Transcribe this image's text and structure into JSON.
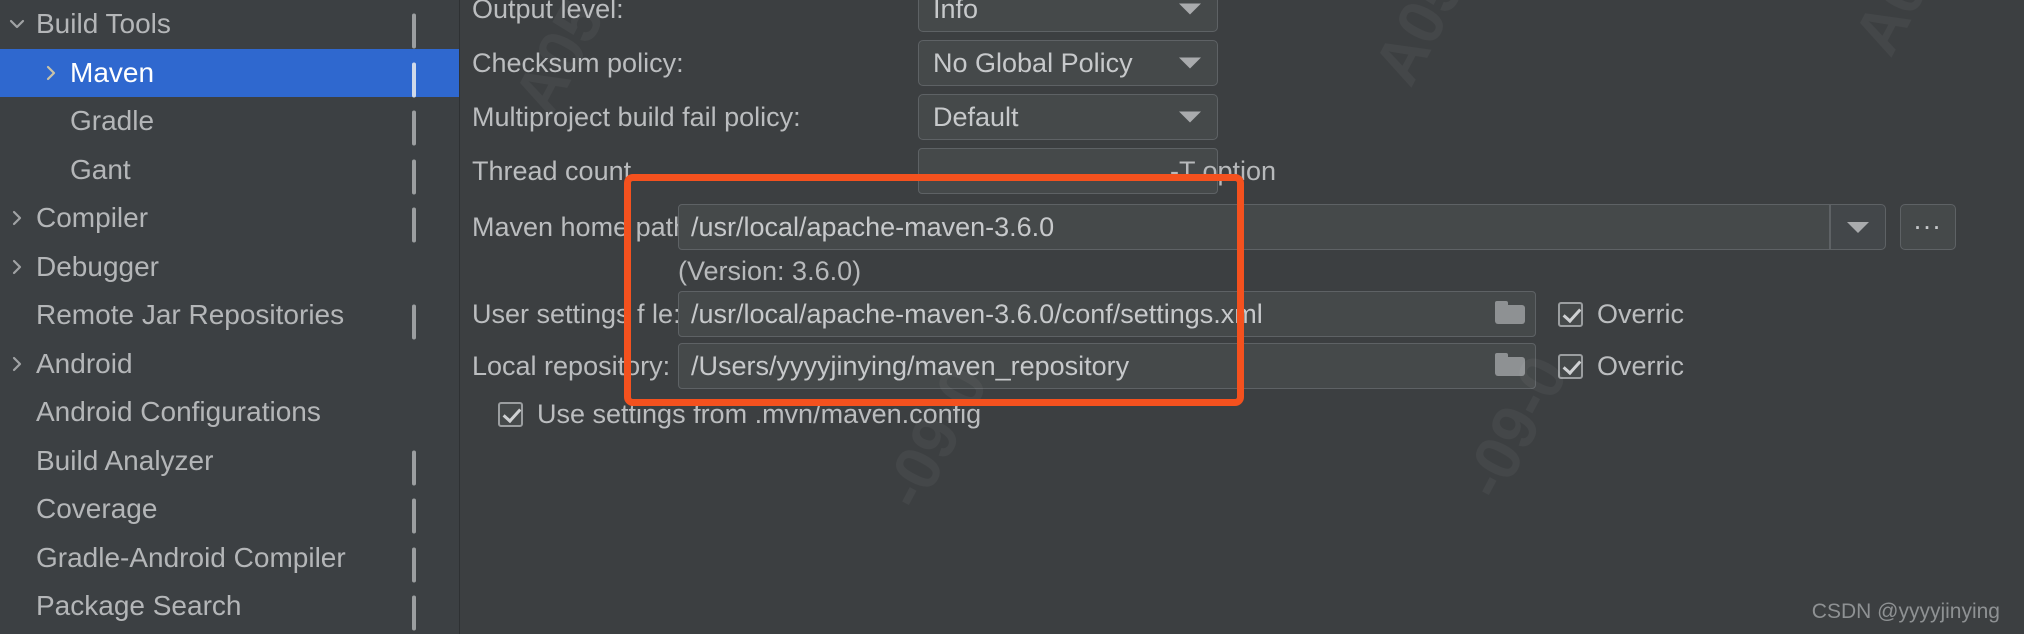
{
  "colors": {
    "accent_selection": "#2f68cf",
    "annotation": "#f4511e",
    "panel_bg": "#3c3f41",
    "sidebar_bg": "#3c4043",
    "field_bg": "#45494a",
    "text": "#bbbdbf"
  },
  "sidebar": {
    "items": [
      {
        "label": "Build Tools",
        "indent": 0,
        "twisty": "chevron-down",
        "icon": "monitor-icon"
      },
      {
        "label": "Maven",
        "indent": 1,
        "twisty": "chevron-right",
        "icon": "monitor-icon",
        "selected": true
      },
      {
        "label": "Gradle",
        "indent": 1,
        "twisty": "",
        "icon": "monitor-icon"
      },
      {
        "label": "Gant",
        "indent": 1,
        "twisty": "",
        "icon": "monitor-icon"
      },
      {
        "label": "Compiler",
        "indent": 0,
        "twisty": "chevron-right",
        "icon": "monitor-icon"
      },
      {
        "label": "Debugger",
        "indent": 0,
        "twisty": "chevron-right",
        "icon": ""
      },
      {
        "label": "Remote Jar Repositories",
        "indent": 0,
        "twisty": "",
        "icon": "monitor-icon"
      },
      {
        "label": "Android",
        "indent": 0,
        "twisty": "chevron-right",
        "icon": ""
      },
      {
        "label": "Android Configurations",
        "indent": 0,
        "twisty": "",
        "icon": ""
      },
      {
        "label": "Build Analyzer",
        "indent": 0,
        "twisty": "",
        "icon": "monitor-icon"
      },
      {
        "label": "Coverage",
        "indent": 0,
        "twisty": "",
        "icon": "monitor-icon"
      },
      {
        "label": "Gradle-Android Compiler",
        "indent": 0,
        "twisty": "",
        "icon": "monitor-icon"
      },
      {
        "label": "Package Search",
        "indent": 0,
        "twisty": "",
        "icon": "monitor-icon"
      }
    ]
  },
  "form": {
    "output_level": {
      "label": "Output level:",
      "value": "Info"
    },
    "checksum_policy": {
      "label": "Checksum policy:",
      "value": "No Global Policy"
    },
    "multiproject_policy": {
      "label": "Multiproject build fail policy:",
      "value": "Default"
    },
    "thread_count": {
      "label": "Thread count",
      "value": "",
      "hint": "-T option"
    },
    "maven_home_path": {
      "label": "Maven home path:",
      "value": "/usr/local/apache-maven-3.6.0",
      "version_note": "(Version: 3.6.0)",
      "ellipsis_label": "..."
    },
    "user_settings_file": {
      "label": "User settings f le:",
      "value": "/usr/local/apache-maven-3.6.0/conf/settings.xml",
      "override_label": "Overric",
      "override_checked": true
    },
    "local_repository": {
      "label": "Local repository:",
      "value": "/Users/yyyyjinying/maven_repository",
      "override_label": "Overric",
      "override_checked": true
    },
    "use_mvn_config": {
      "label": "Use settings from .mvn/maven.config",
      "checked": true
    }
  },
  "watermarks": {
    "top_right": "A05",
    "mid": "-09-0",
    "left_faint": "09-01",
    "credit": "CSDN @yyyyjinying"
  },
  "icons": {
    "chevron_down": "chevron-down-icon",
    "chevron_right": "chevron-right-icon",
    "monitor": "monitor-icon",
    "folder": "folder-icon",
    "caret_down": "caret-down-icon"
  }
}
